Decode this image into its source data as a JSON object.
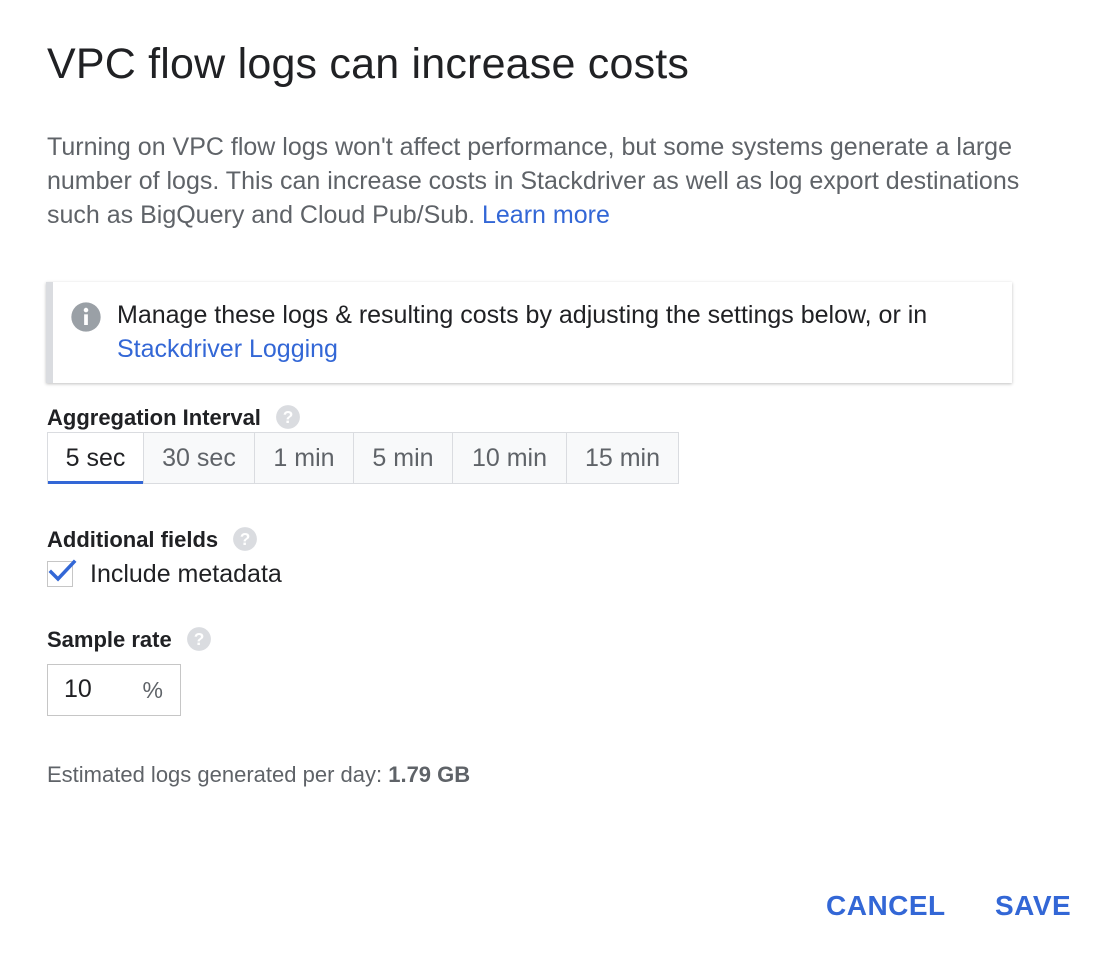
{
  "dialog": {
    "title": "VPC flow logs can increase costs",
    "description": "Turning on VPC flow logs won't affect performance, but some systems generate a large number of logs. This can increase costs in Stackdriver as well as log export destinations such as BigQuery and Cloud Pub/Sub.",
    "learn_more": "Learn more"
  },
  "info_box": {
    "icon": "info-icon",
    "text": "Manage these logs & resulting costs by adjusting the settings below, or in",
    "link": "Stackdriver Logging"
  },
  "aggregation": {
    "label": "Aggregation Interval",
    "help_icon": "help-icon",
    "options": [
      "5 sec",
      "30 sec",
      "1 min",
      "5 min",
      "10 min",
      "15 min"
    ],
    "selected": "5 sec"
  },
  "additional_fields": {
    "label": "Additional fields",
    "help_icon": "help-icon",
    "checkbox_label": "Include metadata",
    "checked": true
  },
  "sample_rate": {
    "label": "Sample rate",
    "help_icon": "help-icon",
    "value": "10",
    "unit": "%"
  },
  "estimate": {
    "label": "Estimated logs generated per day:",
    "value": "1.79 GB"
  },
  "actions": {
    "cancel_label": "CANCEL",
    "save_label": "SAVE"
  },
  "colors": {
    "accent": "#3367d6",
    "text_secondary": "#5f6368",
    "border": "#dadce0"
  }
}
